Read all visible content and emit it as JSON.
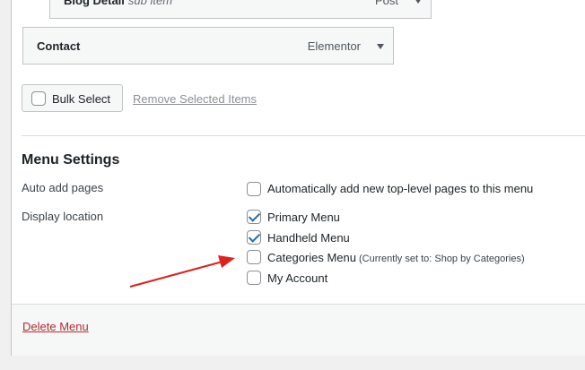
{
  "menu_items": [
    {
      "title": "Blog Detail",
      "sub": "sub item",
      "type": "Post"
    },
    {
      "title": "Contact",
      "sub": "",
      "type": "Elementor"
    }
  ],
  "bulk": {
    "label": "Bulk Select",
    "remove_label": "Remove Selected Items"
  },
  "settings": {
    "title": "Menu Settings",
    "auto_add": {
      "label": "Auto add pages",
      "option": "Automatically add new top-level pages to this menu",
      "checked": false
    },
    "display": {
      "label": "Display location",
      "options": [
        {
          "label": "Primary Menu",
          "note": "",
          "checked": true
        },
        {
          "label": "Handheld Menu",
          "note": "",
          "checked": true
        },
        {
          "label": "Categories Menu",
          "note": "(Currently set to: Shop by Categories)",
          "checked": false
        },
        {
          "label": "My Account",
          "note": "",
          "checked": false
        }
      ]
    }
  },
  "footer": {
    "delete_label": "Delete Menu"
  },
  "colors": {
    "accent": "#2271b1",
    "danger": "#b32d2e",
    "annotation_arrow": "#e02020"
  }
}
